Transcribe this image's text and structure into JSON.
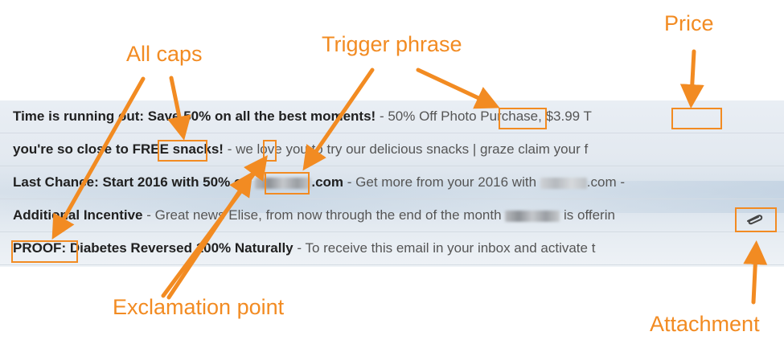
{
  "emails": [
    {
      "subject": "Time is running out: Save 50% on all the best moments!",
      "separator": " - ",
      "snippet": "50% Off Photo Purchase, $3.99 T"
    },
    {
      "subject": "you're so close to FREE snacks!",
      "separator": " - ",
      "snippet": "we love you to try our delicious snacks | graze claim your f"
    },
    {
      "subject_before": "Last Chance: Start 2016 with 50% off ",
      "subject_after": ".com",
      "separator": " - ",
      "snippet_before": "Get more from your 2016 with ",
      "snippet_after": ".com -"
    },
    {
      "subject": "Additional Incentive",
      "separator": " - ",
      "snippet_before": "Great news Elise, from now through the end of the month ",
      "snippet_after": " is offerin"
    },
    {
      "subject": "PROOF: Diabetes Reversed 100% Naturally",
      "separator": " - ",
      "snippet": "To receive this email in your inbox and activate t"
    }
  ],
  "annotations": {
    "all_caps": "All caps",
    "trigger_phrase": "Trigger phrase",
    "price": "Price",
    "exclamation_point": "Exclamation point",
    "attachment": "Attachment"
  },
  "colors": {
    "accent": "#f28b22",
    "subject": "#202020",
    "snippet": "#555555"
  },
  "icons": {
    "attachment": "paperclip-icon"
  }
}
